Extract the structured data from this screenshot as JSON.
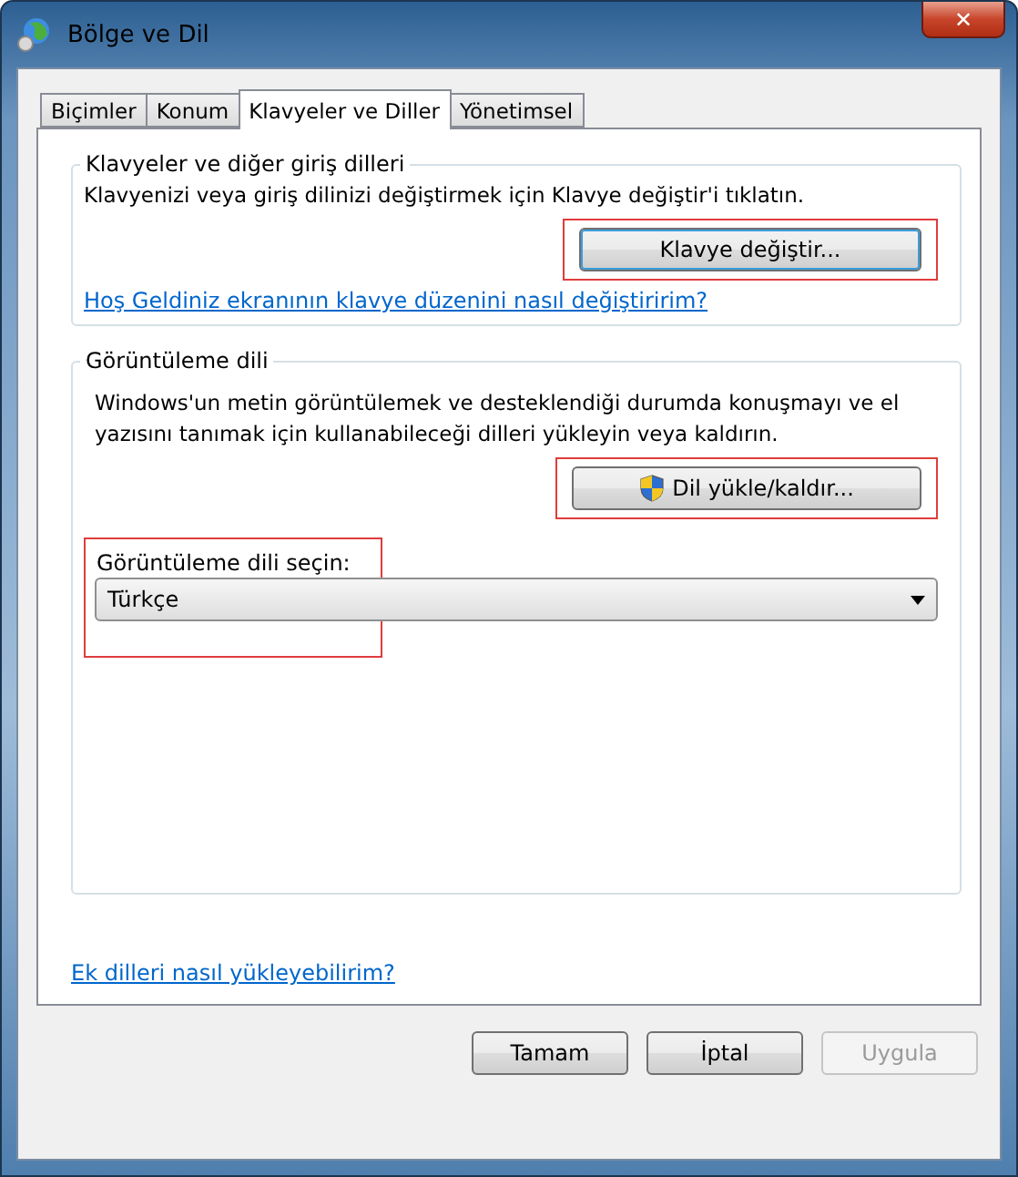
{
  "window": {
    "title": "Bölge ve Dil",
    "close": "✕"
  },
  "tabs": [
    {
      "label": "Biçimler",
      "selected": false
    },
    {
      "label": "Konum",
      "selected": false
    },
    {
      "label": "Klavyeler ve Diller",
      "selected": true
    },
    {
      "label": "Yönetimsel",
      "selected": false
    }
  ],
  "keyboards_group": {
    "title": "Klavyeler ve diğer giriş dilleri",
    "text": "Klavyenizi veya giriş dilinizi değiştirmek için Klavye değiştir'i tıklatın.",
    "button": {
      "label": "Klavye değiştir...",
      "highlighted": true
    },
    "link": "Hoş Geldiniz ekranının klavye düzenini nasıl değiştiririm?"
  },
  "display_group": {
    "title": "Görüntüleme dili",
    "text": "Windows'un metin görüntülemek ve desteklendiği durumda konuşmayı ve el yazısını tanımak için kullanabileceği dilleri yükleyin veya kaldırın.",
    "button": {
      "label": "Dil yükle/kaldır...",
      "highlighted": true
    },
    "select_label": "Görüntüleme dili seçin:",
    "select_value": "Türkçe",
    "select_highlighted": true
  },
  "link": "Ek dilleri nasıl yükleyebilirim?",
  "buttons": [
    {
      "label": "Tamam",
      "disabled": false
    },
    {
      "label": "İptal",
      "disabled": false
    },
    {
      "label": "Uygula",
      "disabled": true
    }
  ]
}
